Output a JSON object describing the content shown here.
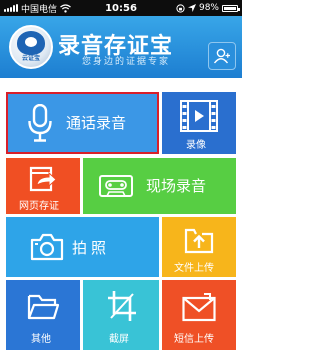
{
  "status_bar": {
    "carrier": "中国电信",
    "time": "10:56",
    "battery": "98%",
    "battery_level": 0.98
  },
  "header": {
    "title": "录音存证宝",
    "slogan": "您身边的证据专家",
    "logo_text": "云证宝"
  },
  "tiles": {
    "call_recording": "通话录音",
    "video": "录像",
    "web_evidence": "网页存证",
    "scene_recording": "现场录音",
    "photo": "拍照",
    "file_upload": "文件上传",
    "other": "其他",
    "screenshot": "截屏",
    "sms_upload": "短信上传"
  },
  "colors": {
    "header": "#2a90dd",
    "call": "#3b97e6",
    "video": "#2a6fcf",
    "web": "#f04f23",
    "scene": "#57ce43",
    "photo": "#2ea4e8",
    "file": "#f7b51b",
    "other": "#2b76d5",
    "screenshot": "#39c3d6",
    "sms": "#ef5026",
    "highlight_border": "#d81f2a"
  }
}
